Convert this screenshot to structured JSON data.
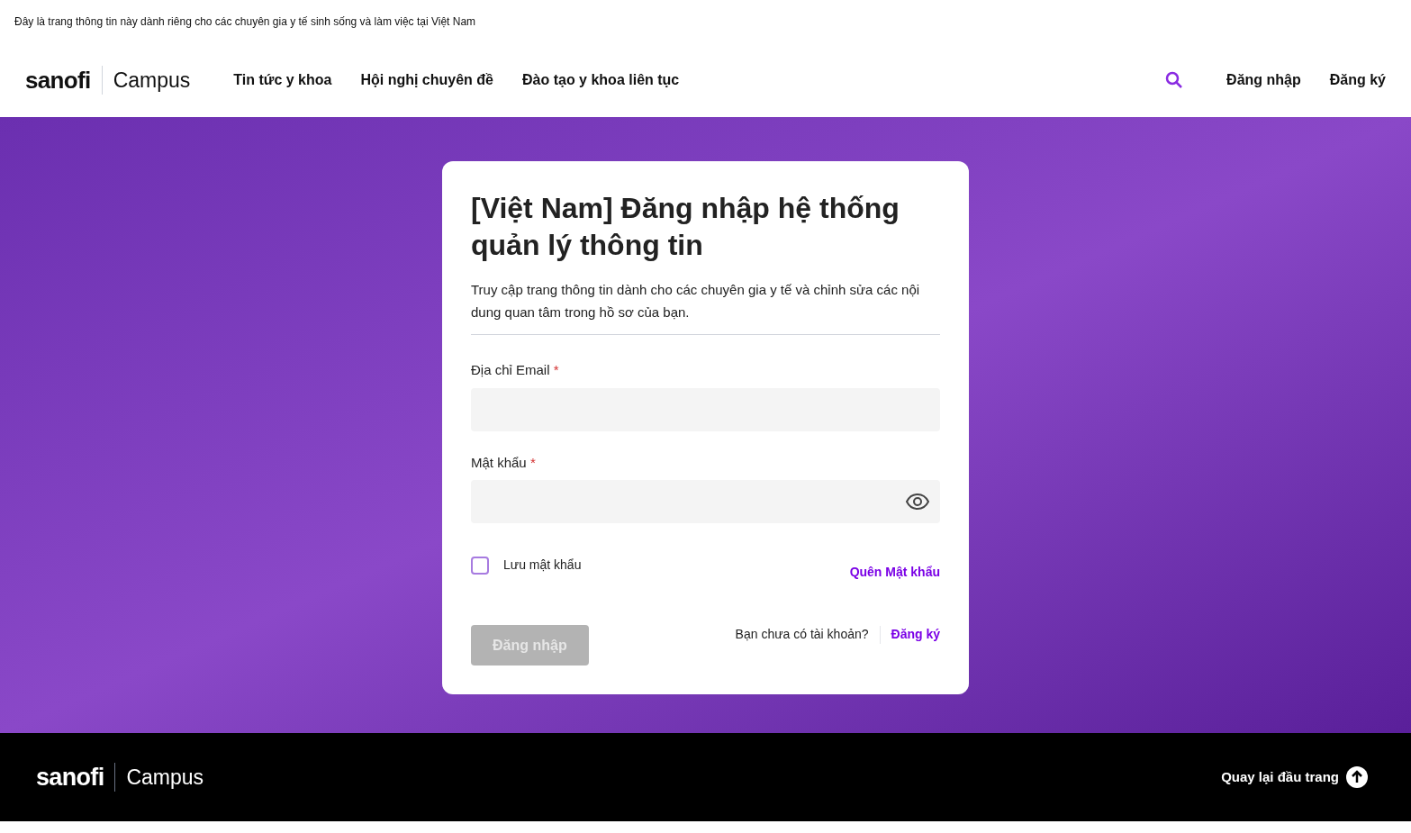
{
  "notice_bar": {
    "text": "Đây là trang thông tin này dành riêng cho các chuyên gia y tế sinh sống và làm việc tại Việt Nam"
  },
  "header": {
    "logo": {
      "brand": "sanofi",
      "product": "Campus"
    },
    "nav": [
      {
        "label": "Tin tức y khoa"
      },
      {
        "label": "Hội nghị chuyên đề"
      },
      {
        "label": "Đào tạo y khoa liên tục"
      }
    ],
    "actions": [
      {
        "label": "Đăng nhập"
      },
      {
        "label": "Đăng ký"
      }
    ]
  },
  "login_card": {
    "title": "[Việt Nam] Đăng nhập hệ thống quản lý thông tin",
    "description": "Truy cập trang thông tin dành cho các chuyên gia y tế và chỉnh sửa các nội dung quan tâm trong hồ sơ của bạn.",
    "fields": [
      {
        "kind": "text",
        "label": "Địa chỉ Email",
        "required_mark": "*"
      },
      {
        "kind": "password",
        "label": "Mật khẩu",
        "required_mark": "*"
      }
    ],
    "remember": {
      "label": "Lưu mật khẩu",
      "checked": false
    },
    "forgot_link": "Quên Mật khẩu",
    "submit": {
      "label": "Đăng nhập",
      "disabled": true
    },
    "signup_prompt": "Bạn chưa có tài khoản?",
    "signup_link": "Đăng ký"
  },
  "footer": {
    "logo": {
      "brand": "sanofi",
      "product": "Campus"
    },
    "back_to_top": "Quay lại đầu trang"
  }
}
